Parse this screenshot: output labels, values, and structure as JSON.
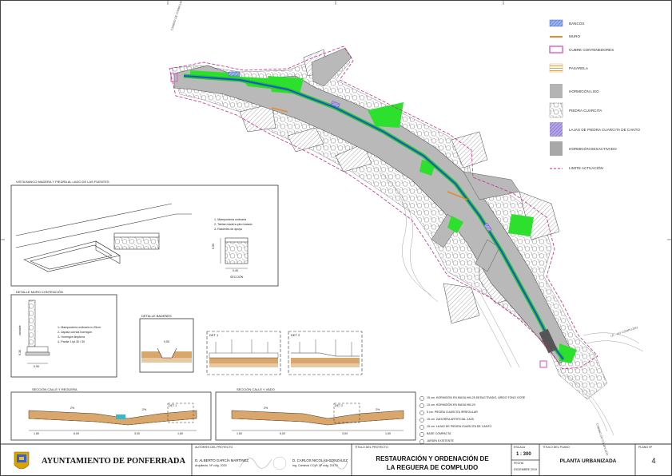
{
  "road_labels": {
    "top_road": "CAMINO DE COMPLUDO",
    "right_road": "LE - 142 COMPLUDO",
    "bottom_road": "CAMINO DE COMPLUDO"
  },
  "legend": {
    "items": [
      {
        "key": "bancos",
        "label": "BANCOS",
        "swatch": "blue-hatch",
        "color": "#5b7fd6"
      },
      {
        "key": "muro",
        "label": "MURO",
        "swatch": "orange-line",
        "color": "#e38a2a"
      },
      {
        "key": "cubre",
        "label": "CUBRE CONTENEDORES",
        "swatch": "pink-box",
        "color": "#e066c8"
      },
      {
        "key": "pasarela",
        "label": "PASARELA",
        "swatch": "orange-stripes",
        "color": "#e8a040"
      },
      {
        "key": "hormigon_liso",
        "label": "HORMIGÓN LISO",
        "swatch": "grey-fill",
        "color": "#b4b4b4"
      },
      {
        "key": "piedra",
        "label": "PIEDRA CUARCITA",
        "swatch": "stone",
        "color": "#ffffff"
      },
      {
        "key": "lajas",
        "label": "LAJAS DE PIEDRA CUARCITA DE CANTO",
        "swatch": "purple-hatch",
        "color": "#8a72cc"
      },
      {
        "key": "desactivado",
        "label": "HORMIGÓN DESACTIVADO",
        "swatch": "grey-dark",
        "color": "#a8a8a8"
      },
      {
        "key": "limite",
        "label": "LIMITE ACTUACIÓN",
        "swatch": "magenta-dash",
        "color": "#cc2a8a"
      }
    ]
  },
  "detail_bench": {
    "title": "VISTA BANCO MADERA Y PIEDRA AL LADO DE LAS FUENTES",
    "notes": [
      "1- Mampostería ordinaria",
      "2- Tablas madera pino tratado",
      "3- Rastreles de apoyo"
    ],
    "dim_height": "0,50",
    "dim_width": "0,45",
    "caption": "SECCIÓN"
  },
  "detail_wall": {
    "title": "DETALLE MURO CONTENCIÓN",
    "notes": [
      "1- Mampostería ordinaria e=25cm",
      "2- Zapata corrida hormigón",
      "3- Hormigón limpieza",
      "4- Pantla 1 tpi 30 / 30"
    ],
    "dim_width": "0,50",
    "dim_h1": "0,30",
    "dim_h2": "variable"
  },
  "detail_bancos": {
    "title": "DETALLE BADENES",
    "dim": "0,50"
  },
  "det1": {
    "title": "DET 1"
  },
  "det2": {
    "title": "DET 2"
  },
  "section_left": {
    "title": "SECCIÓN CALLE Y REGUERA",
    "det": "DET 1",
    "dims": [
      "1,80",
      "6,00",
      "3,00",
      "1,60"
    ],
    "pcts": [
      "2%",
      "2%"
    ]
  },
  "section_right": {
    "title": "SECCIÓN CALLE Y VADO",
    "det": "DET 2",
    "dims": [
      "1,60",
      "6,00",
      "3,00",
      "1,60"
    ],
    "pcts": [
      "2%",
      "2%"
    ]
  },
  "section_notes": [
    "15 cm. HORMIGÓN EN MASA HM-25 DESACTIVADO, ÁRIDO TONO OCRE",
    "10 cm. HORMIGÓN EN MASA HM-20",
    "5 cm. PIEDRA CUARCITA IRREGULAR",
    "15 cm. ZAHORRA ARTIFICIAL ZA25",
    "15 cm. LAJAS DE PIEDRA CUARCITA DE CANTO",
    "BASE COMPACTA",
    "JARDÍN EXISTENTE"
  ],
  "title_block": {
    "client": "AYUNTAMIENTO DE PONFERRADA",
    "authors_label": "AUTOR/ES DEL PROYECTO",
    "author1": "D. ALBERTO GARCÍA MARTÍNEZ",
    "author1_sub": "Arquitecto, Nº colg. 2033",
    "author2": "D. CARLOS NICOLÁS GONZÁLEZ",
    "author2_sub": "Ing. Caminos CCyP, Nº colg. 20179",
    "project_label": "TÍTULO DEL PROYECTO",
    "project_line1": "RESTAURACIÓN Y ORDENACIÓN DE",
    "project_line2": "LA REGUERA DE COMPLUDO",
    "scale_label": "ESCALA",
    "scale": "1 : 300",
    "date_label": "FECHA",
    "date": "DICIEMBRE 2019",
    "plan_label": "TÍTULO DEL PLANO",
    "plan": "PLANTA URBANIZADA",
    "number_label": "PLANO Nº",
    "number": "4"
  }
}
